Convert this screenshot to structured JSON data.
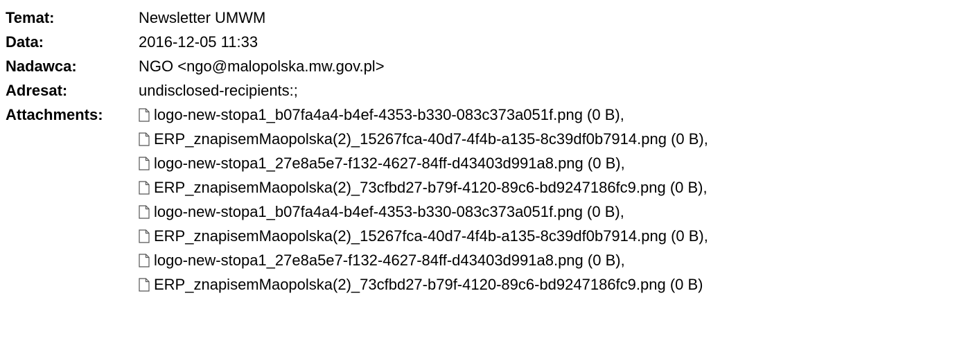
{
  "header": {
    "subject_label": "Temat:",
    "subject_value": "Newsletter UMWM",
    "date_label": "Data:",
    "date_value": "2016-12-05 11:33",
    "from_label": "Nadawca:",
    "from_value": "NGO <ngo@malopolska.mw.gov.pl>",
    "to_label": "Adresat:",
    "to_value": "undisclosed-recipients:;",
    "attachments_label": "Attachments:"
  },
  "attachments": [
    {
      "name": "logo-new-stopa1_b07fa4a4-b4ef-4353-b330-083c373a051f.png (0 B),",
      "icon": "file-icon"
    },
    {
      "name": "ERP_znapisemMaopolska(2)_15267fca-40d7-4f4b-a135-8c39df0b7914.png (0 B),",
      "icon": "file-icon"
    },
    {
      "name": "logo-new-stopa1_27e8a5e7-f132-4627-84ff-d43403d991a8.png (0 B),",
      "icon": "file-icon"
    },
    {
      "name": "ERP_znapisemMaopolska(2)_73cfbd27-b79f-4120-89c6-bd9247186fc9.png (0 B),",
      "icon": "file-icon"
    },
    {
      "name": "logo-new-stopa1_b07fa4a4-b4ef-4353-b330-083c373a051f.png (0 B),",
      "icon": "file-icon"
    },
    {
      "name": "ERP_znapisemMaopolska(2)_15267fca-40d7-4f4b-a135-8c39df0b7914.png (0 B),",
      "icon": "file-icon"
    },
    {
      "name": "logo-new-stopa1_27e8a5e7-f132-4627-84ff-d43403d991a8.png (0 B),",
      "icon": "file-icon"
    },
    {
      "name": "ERP_znapisemMaopolska(2)_73cfbd27-b79f-4120-89c6-bd9247186fc9.png (0 B)",
      "icon": "file-icon"
    }
  ]
}
